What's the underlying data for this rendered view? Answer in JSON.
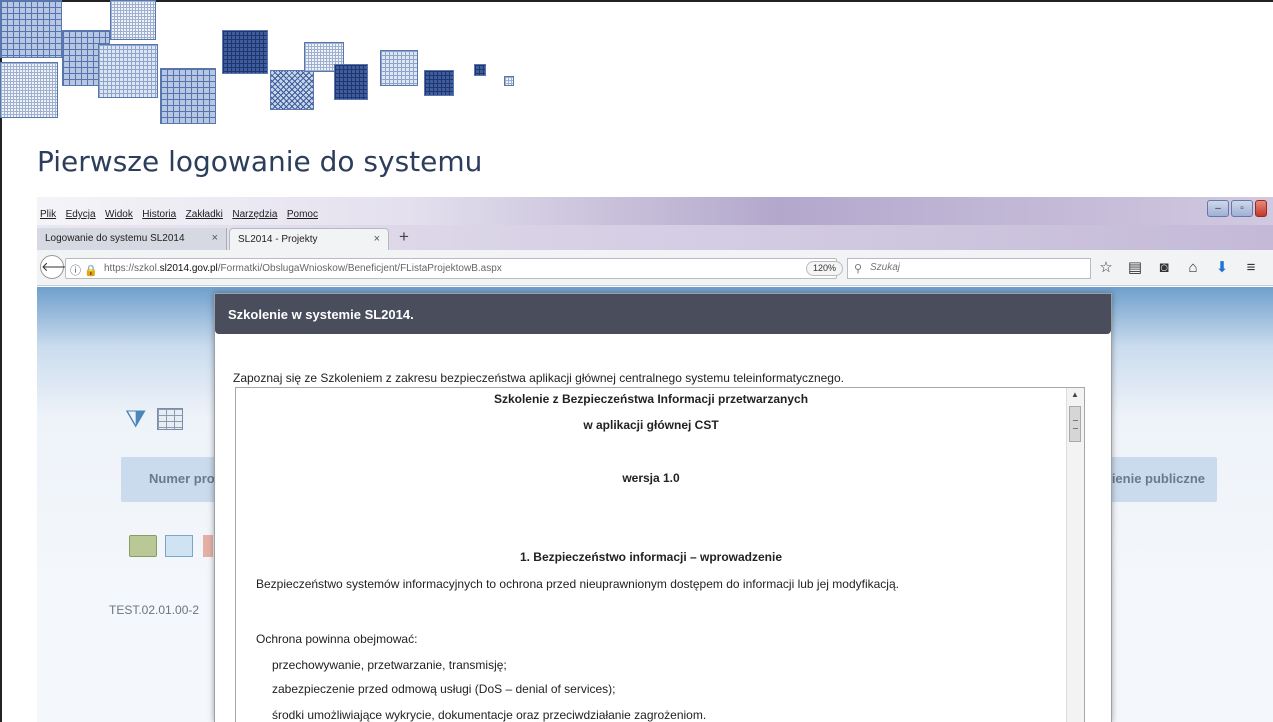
{
  "slide": {
    "title": "Pierwsze logowanie do systemu"
  },
  "browser": {
    "menu": [
      "Plik",
      "Edycja",
      "Widok",
      "Historia",
      "Zakładki",
      "Narzędzia",
      "Pomoc"
    ],
    "tabs": [
      {
        "label": "Logowanie do systemu SL2014",
        "close": "×"
      },
      {
        "label": "SL2014 - Projekty",
        "close": "×"
      }
    ],
    "new_tab": "+",
    "url_prefix": "https://szkol.",
    "url_domain": "sl2014.gov.pl",
    "url_path": "/Formatki/ObslugaWnioskow/Beneficjent/FListaProjektowB.aspx",
    "zoom": "120%",
    "search_placeholder": "Szukaj"
  },
  "app": {
    "column_left": "Numer pro",
    "column_right": "ienie publiczne",
    "row_text": "TEST.02.01.00-2"
  },
  "modal": {
    "title": "Szkolenie w systemie SL2014.",
    "intro": "Zapoznaj się ze Szkoleniem z zakresu bezpieczeństwa aplikacji głównej centralnego systemu teleinformatycznego.",
    "doc_title_1": "Szkolenie z Bezpieczeństwa Informacji przetwarzanych",
    "doc_title_2": "w aplikacji głównej CST",
    "version": "wersja 1.0",
    "section_1": "1. Bezpieczeństwo informacji – wprowadzenie",
    "para_1": "Bezpieczeństwo systemów informacyjnych to ochrona przed nieuprawnionym dostępem do informacji lub jej modyfikacją.",
    "para_2": "Ochrona powinna obejmować:",
    "bullets": [
      "przechowywanie, przetwarzanie, transmisję;",
      "zabezpieczenie przed odmową usługi (DoS – denial of services);",
      "środki umożliwiające wykrycie, dokumentacje oraz przeciwdziałanie zagrożeniom."
    ]
  }
}
